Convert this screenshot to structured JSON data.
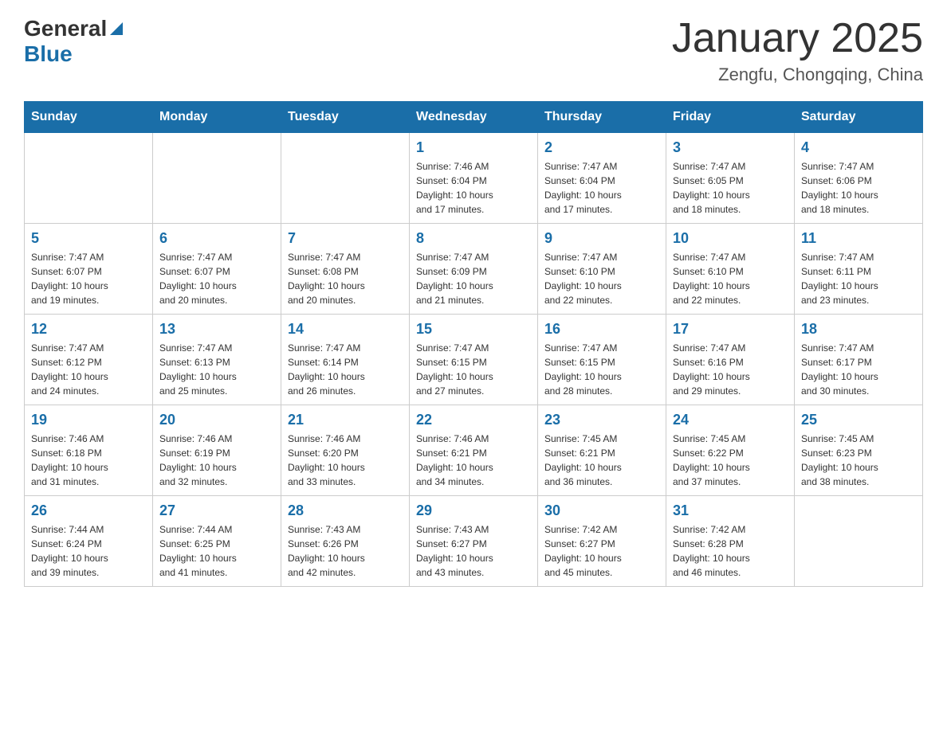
{
  "header": {
    "logo_general": "General",
    "logo_blue": "Blue",
    "title": "January 2025",
    "subtitle": "Zengfu, Chongqing, China"
  },
  "days_of_week": [
    "Sunday",
    "Monday",
    "Tuesday",
    "Wednesday",
    "Thursday",
    "Friday",
    "Saturday"
  ],
  "weeks": [
    {
      "days": [
        {
          "number": "",
          "info": ""
        },
        {
          "number": "",
          "info": ""
        },
        {
          "number": "",
          "info": ""
        },
        {
          "number": "1",
          "info": "Sunrise: 7:46 AM\nSunset: 6:04 PM\nDaylight: 10 hours\nand 17 minutes."
        },
        {
          "number": "2",
          "info": "Sunrise: 7:47 AM\nSunset: 6:04 PM\nDaylight: 10 hours\nand 17 minutes."
        },
        {
          "number": "3",
          "info": "Sunrise: 7:47 AM\nSunset: 6:05 PM\nDaylight: 10 hours\nand 18 minutes."
        },
        {
          "number": "4",
          "info": "Sunrise: 7:47 AM\nSunset: 6:06 PM\nDaylight: 10 hours\nand 18 minutes."
        }
      ]
    },
    {
      "days": [
        {
          "number": "5",
          "info": "Sunrise: 7:47 AM\nSunset: 6:07 PM\nDaylight: 10 hours\nand 19 minutes."
        },
        {
          "number": "6",
          "info": "Sunrise: 7:47 AM\nSunset: 6:07 PM\nDaylight: 10 hours\nand 20 minutes."
        },
        {
          "number": "7",
          "info": "Sunrise: 7:47 AM\nSunset: 6:08 PM\nDaylight: 10 hours\nand 20 minutes."
        },
        {
          "number": "8",
          "info": "Sunrise: 7:47 AM\nSunset: 6:09 PM\nDaylight: 10 hours\nand 21 minutes."
        },
        {
          "number": "9",
          "info": "Sunrise: 7:47 AM\nSunset: 6:10 PM\nDaylight: 10 hours\nand 22 minutes."
        },
        {
          "number": "10",
          "info": "Sunrise: 7:47 AM\nSunset: 6:10 PM\nDaylight: 10 hours\nand 22 minutes."
        },
        {
          "number": "11",
          "info": "Sunrise: 7:47 AM\nSunset: 6:11 PM\nDaylight: 10 hours\nand 23 minutes."
        }
      ]
    },
    {
      "days": [
        {
          "number": "12",
          "info": "Sunrise: 7:47 AM\nSunset: 6:12 PM\nDaylight: 10 hours\nand 24 minutes."
        },
        {
          "number": "13",
          "info": "Sunrise: 7:47 AM\nSunset: 6:13 PM\nDaylight: 10 hours\nand 25 minutes."
        },
        {
          "number": "14",
          "info": "Sunrise: 7:47 AM\nSunset: 6:14 PM\nDaylight: 10 hours\nand 26 minutes."
        },
        {
          "number": "15",
          "info": "Sunrise: 7:47 AM\nSunset: 6:15 PM\nDaylight: 10 hours\nand 27 minutes."
        },
        {
          "number": "16",
          "info": "Sunrise: 7:47 AM\nSunset: 6:15 PM\nDaylight: 10 hours\nand 28 minutes."
        },
        {
          "number": "17",
          "info": "Sunrise: 7:47 AM\nSunset: 6:16 PM\nDaylight: 10 hours\nand 29 minutes."
        },
        {
          "number": "18",
          "info": "Sunrise: 7:47 AM\nSunset: 6:17 PM\nDaylight: 10 hours\nand 30 minutes."
        }
      ]
    },
    {
      "days": [
        {
          "number": "19",
          "info": "Sunrise: 7:46 AM\nSunset: 6:18 PM\nDaylight: 10 hours\nand 31 minutes."
        },
        {
          "number": "20",
          "info": "Sunrise: 7:46 AM\nSunset: 6:19 PM\nDaylight: 10 hours\nand 32 minutes."
        },
        {
          "number": "21",
          "info": "Sunrise: 7:46 AM\nSunset: 6:20 PM\nDaylight: 10 hours\nand 33 minutes."
        },
        {
          "number": "22",
          "info": "Sunrise: 7:46 AM\nSunset: 6:21 PM\nDaylight: 10 hours\nand 34 minutes."
        },
        {
          "number": "23",
          "info": "Sunrise: 7:45 AM\nSunset: 6:21 PM\nDaylight: 10 hours\nand 36 minutes."
        },
        {
          "number": "24",
          "info": "Sunrise: 7:45 AM\nSunset: 6:22 PM\nDaylight: 10 hours\nand 37 minutes."
        },
        {
          "number": "25",
          "info": "Sunrise: 7:45 AM\nSunset: 6:23 PM\nDaylight: 10 hours\nand 38 minutes."
        }
      ]
    },
    {
      "days": [
        {
          "number": "26",
          "info": "Sunrise: 7:44 AM\nSunset: 6:24 PM\nDaylight: 10 hours\nand 39 minutes."
        },
        {
          "number": "27",
          "info": "Sunrise: 7:44 AM\nSunset: 6:25 PM\nDaylight: 10 hours\nand 41 minutes."
        },
        {
          "number": "28",
          "info": "Sunrise: 7:43 AM\nSunset: 6:26 PM\nDaylight: 10 hours\nand 42 minutes."
        },
        {
          "number": "29",
          "info": "Sunrise: 7:43 AM\nSunset: 6:27 PM\nDaylight: 10 hours\nand 43 minutes."
        },
        {
          "number": "30",
          "info": "Sunrise: 7:42 AM\nSunset: 6:27 PM\nDaylight: 10 hours\nand 45 minutes."
        },
        {
          "number": "31",
          "info": "Sunrise: 7:42 AM\nSunset: 6:28 PM\nDaylight: 10 hours\nand 46 minutes."
        },
        {
          "number": "",
          "info": ""
        }
      ]
    }
  ]
}
